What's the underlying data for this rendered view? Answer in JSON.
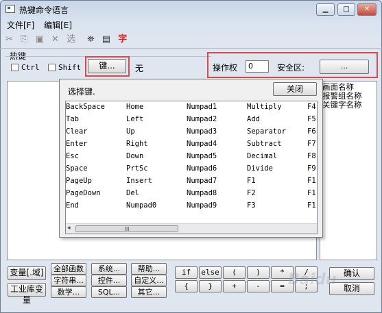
{
  "window": {
    "title": "热键命令语言",
    "controls": {
      "minimize": "▁",
      "maximize": "□",
      "close": "✕"
    }
  },
  "menu": [
    {
      "label": "文件[F]"
    },
    {
      "label": "编辑[E]"
    }
  ],
  "toolbar": [
    {
      "icon": "cut-icon",
      "glyph": "✂"
    },
    {
      "icon": "copy-icon",
      "glyph": "⎘"
    },
    {
      "icon": "paste-icon",
      "glyph": "▣"
    },
    {
      "icon": "delete-icon",
      "glyph": "✕"
    },
    {
      "icon": "select-icon",
      "glyph": "选"
    },
    {
      "icon": "find-icon",
      "glyph": "⛯"
    },
    {
      "icon": "replace-icon",
      "glyph": "▤"
    },
    {
      "icon": "font-icon",
      "glyph": "字"
    }
  ],
  "hotkey": {
    "group_label": "热键",
    "ctrl_label": "Ctrl",
    "shift_label": "Shift",
    "key_button": "键...",
    "key_value": "无",
    "permission_label": "操作权",
    "permission_value": "0",
    "security_label": "安全区:",
    "security_button": "..."
  },
  "popup": {
    "title": "选择键.",
    "close_button": "关闭",
    "columns": [
      [
        "BackSpace",
        "Tab",
        "Clear",
        "Enter",
        "Esc",
        "Space",
        "PageUp",
        "PageDown",
        "End"
      ],
      [
        "Home",
        "Left",
        "Up",
        "Right",
        "Down",
        "PrtSc",
        "Insert",
        "Del",
        "Numpad0"
      ],
      [
        "Numpad1",
        "Numpad2",
        "Numpad3",
        "Numpad4",
        "Numpad5",
        "Numpad6",
        "Numpad7",
        "Numpad8",
        "Numpad9"
      ],
      [
        "Multiply",
        "Add",
        "Separator",
        "Subtract",
        "Decimal",
        "Divide",
        "F1",
        "F2",
        "F3"
      ],
      [
        "F4",
        "F5",
        "F6",
        "F7",
        "F8",
        "F9",
        "F1",
        "F1",
        "F1"
      ]
    ],
    "scroll_grip": "III"
  },
  "right_list": [
    "画面名称",
    "报警组名称",
    "关键字名称"
  ],
  "bottom": {
    "var_button": "变量[.域]",
    "lib_button": "工业库变量",
    "func_buttons": [
      [
        "全部函数",
        "系统...",
        "帮助..."
      ],
      [
        "字符串...",
        "控件...",
        "自定义..."
      ],
      [
        "数学...",
        "SQL...",
        "其它..."
      ]
    ],
    "op_row1": [
      "if",
      "else",
      "(",
      ")",
      "*",
      "/"
    ],
    "op_row2": [
      "{",
      "}",
      "+",
      "-",
      "=",
      ";"
    ],
    "ok_button": "确认",
    "cancel_button": "取消"
  },
  "watermark": "Baidu"
}
